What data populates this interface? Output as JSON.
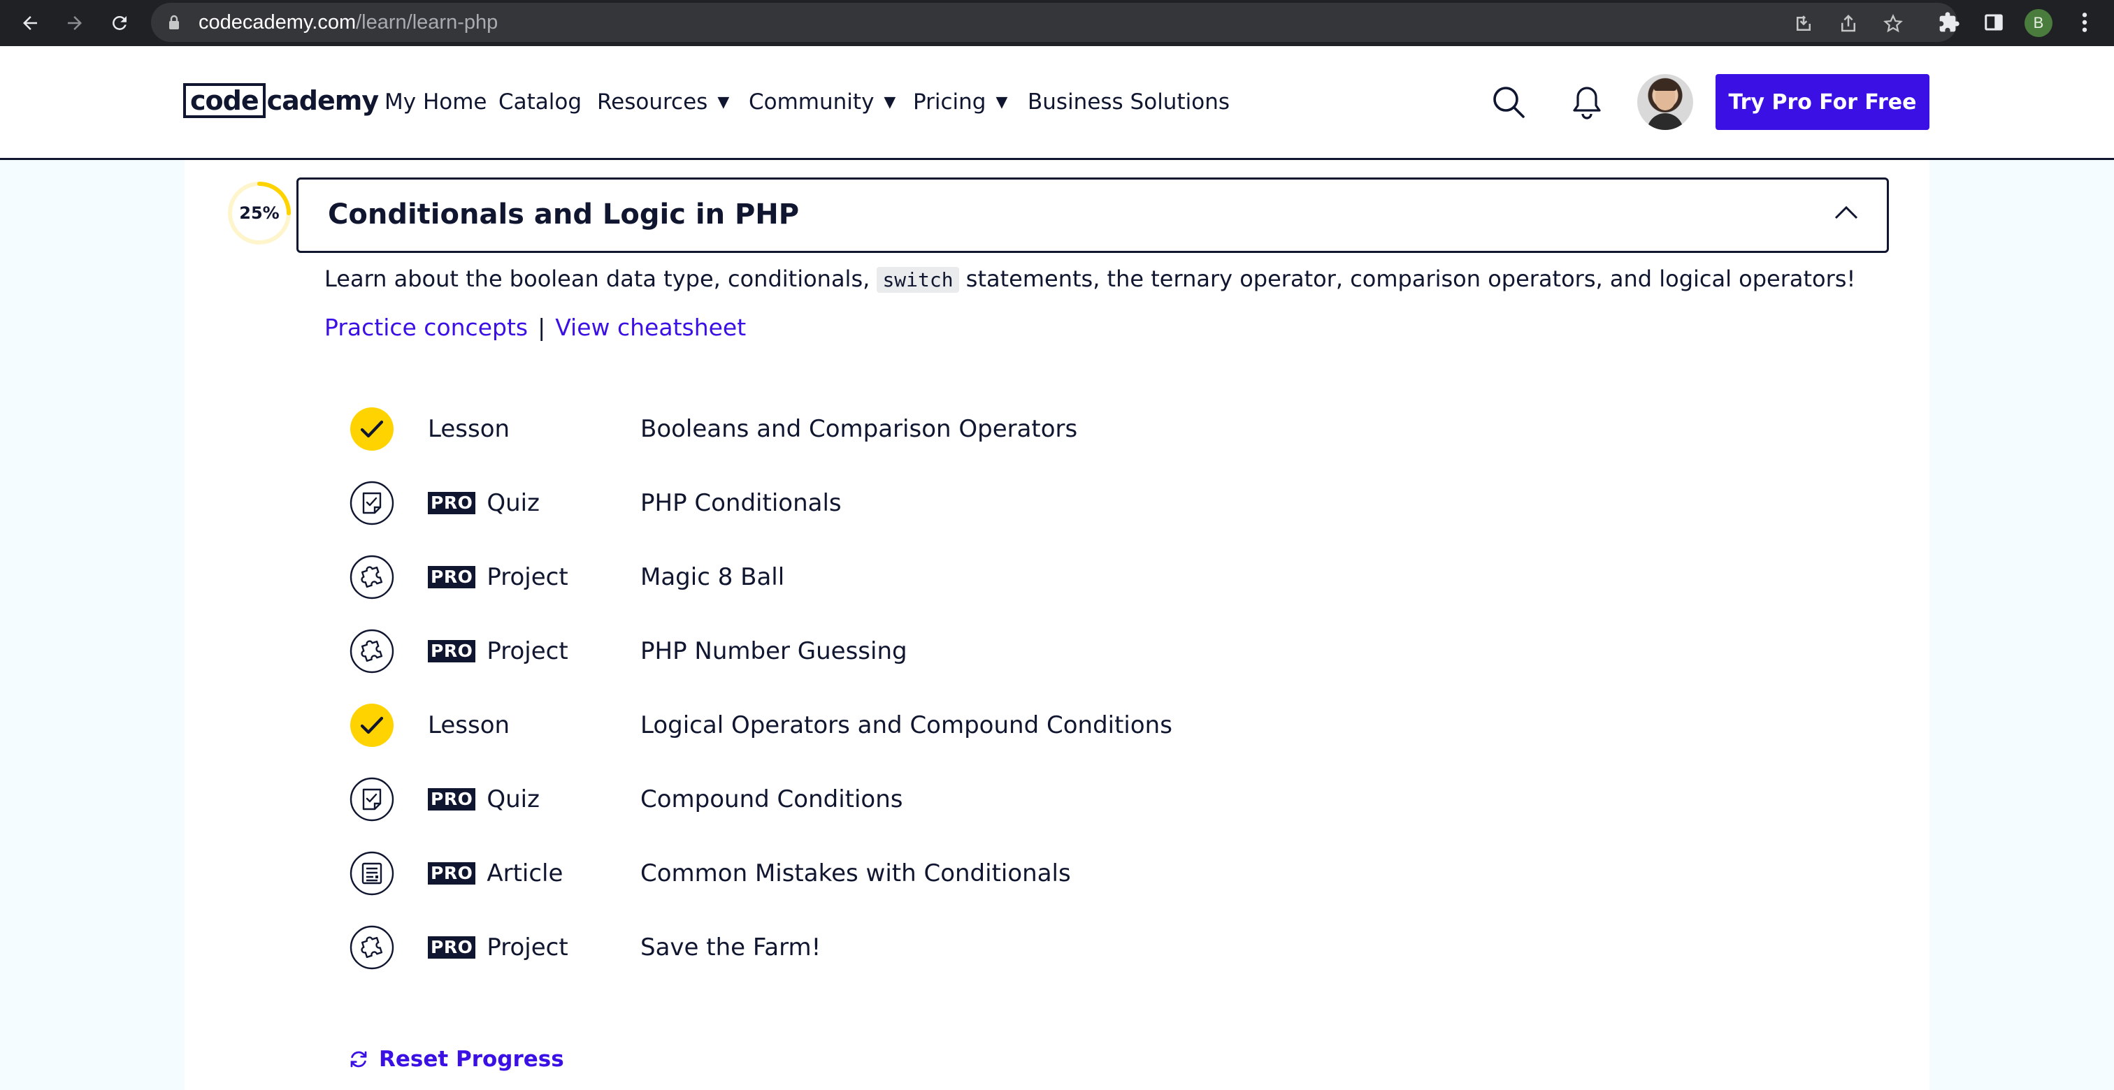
{
  "browser": {
    "url_host": "codecademy.com",
    "url_path": "/learn/learn-php",
    "profile_initial": "B"
  },
  "header": {
    "logo_boxed": "code",
    "logo_rest": "cademy",
    "nav": [
      {
        "label": "My Home",
        "dropdown": false
      },
      {
        "label": "Catalog",
        "dropdown": false
      },
      {
        "label": "Resources",
        "dropdown": true
      },
      {
        "label": "Community",
        "dropdown": true
      },
      {
        "label": "Pricing",
        "dropdown": true
      },
      {
        "label": "Business Solutions",
        "dropdown": false
      }
    ],
    "caret": "▼",
    "cta_label": "Try Pro For Free"
  },
  "module": {
    "progress_text": "25%",
    "progress_fraction": 0.25,
    "title": "Conditionals and Logic in PHP",
    "description_before": "Learn about the boolean data type, conditionals,",
    "description_code": "switch",
    "description_after": "statements, the ternary operator, comparison operators, and logical operators!",
    "practice_link": "Practice concepts",
    "separator": "|",
    "cheatsheet_link": "View cheatsheet",
    "items": [
      {
        "type": "Lesson",
        "pro": false,
        "title": "Booleans and Comparison Operators",
        "icon": "check-icon",
        "completed": true
      },
      {
        "type": "Quiz",
        "pro": true,
        "title": "PHP Conditionals",
        "icon": "quiz-icon",
        "completed": false
      },
      {
        "type": "Project",
        "pro": true,
        "title": "Magic 8 Ball",
        "icon": "puzzle-icon",
        "completed": false
      },
      {
        "type": "Project",
        "pro": true,
        "title": "PHP Number Guessing",
        "icon": "puzzle-icon",
        "completed": false
      },
      {
        "type": "Lesson",
        "pro": false,
        "title": "Logical Operators and Compound Conditions",
        "icon": "check-icon",
        "completed": true
      },
      {
        "type": "Quiz",
        "pro": true,
        "title": "Compound Conditions",
        "icon": "quiz-icon",
        "completed": false
      },
      {
        "type": "Article",
        "pro": true,
        "title": "Common Mistakes with Conditionals",
        "icon": "article-icon",
        "completed": false
      },
      {
        "type": "Project",
        "pro": true,
        "title": "Save the Farm!",
        "icon": "puzzle-icon",
        "completed": false
      }
    ],
    "pro_badge": "PRO",
    "reset_label": "Reset Progress"
  },
  "colors": {
    "accent": "#3a10e5",
    "navy": "#10162f",
    "yellow": "#ffd300",
    "background": "#f5fcff"
  }
}
